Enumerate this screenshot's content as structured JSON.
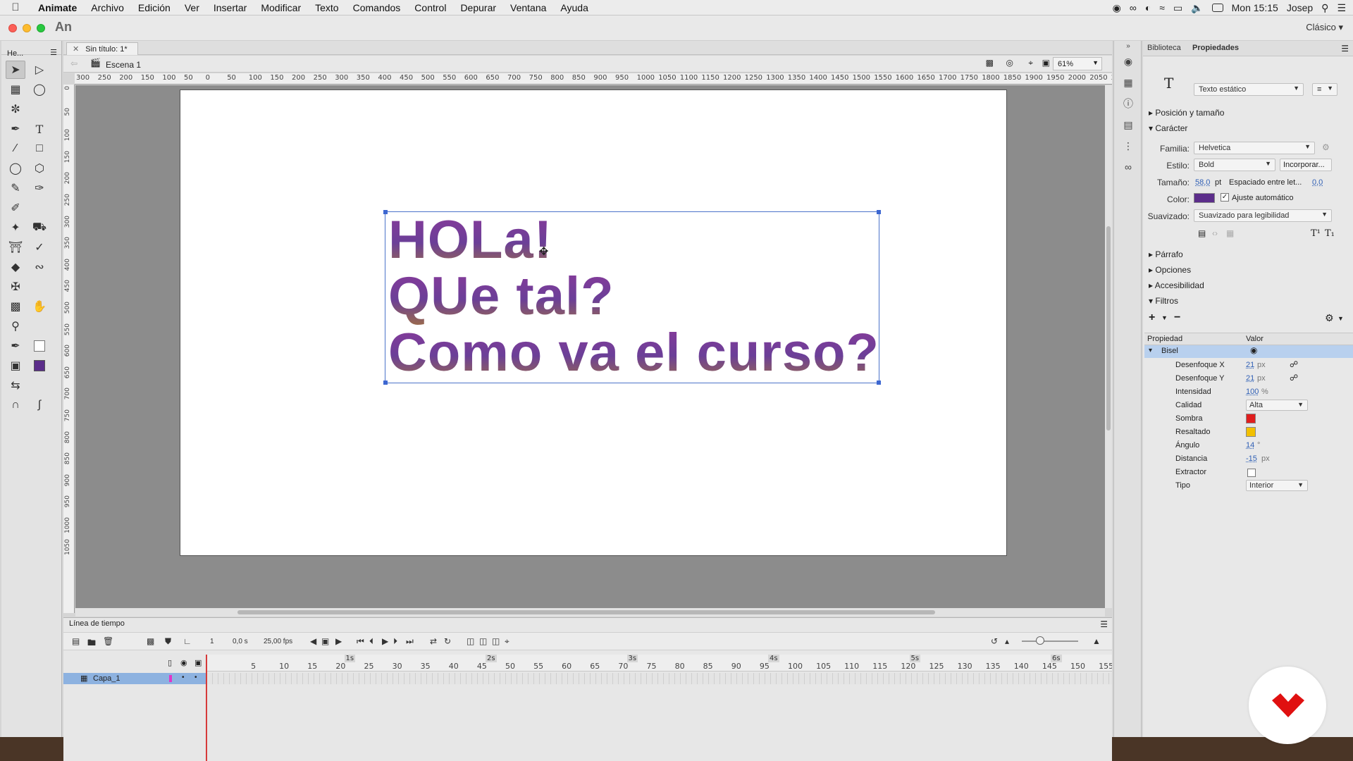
{
  "menubar": {
    "items": [
      "Animate",
      "Archivo",
      "Edición",
      "Ver",
      "Insertar",
      "Modificar",
      "Texto",
      "Comandos",
      "Control",
      "Depurar",
      "Ventana",
      "Ayuda"
    ],
    "clock": "Mon 15:15",
    "user": "Josep"
  },
  "titlebar": {
    "logo": "An",
    "workspace": "Clásico"
  },
  "tools_panel": {
    "title": "He..."
  },
  "document": {
    "tab": "Sin título: 1*",
    "scene": "Escena 1",
    "zoom": "61%"
  },
  "rulers": {
    "h_ticks": [
      "300",
      "250",
      "200",
      "150",
      "100",
      "50",
      "0",
      "50",
      "100",
      "150",
      "200",
      "250",
      "300",
      "350",
      "400",
      "450",
      "500",
      "550",
      "600",
      "650",
      "700",
      "750",
      "800",
      "850",
      "900",
      "950",
      "1000",
      "1050",
      "1100",
      "1150",
      "1200",
      "1250",
      "1300",
      "1350",
      "1400",
      "1450",
      "1500",
      "1550",
      "1600",
      "1650",
      "1700",
      "1750",
      "1800",
      "1850",
      "1900",
      "1950",
      "2000",
      "2050",
      "2"
    ],
    "v_ticks": [
      "0",
      "50",
      "100",
      "150",
      "200",
      "250",
      "300",
      "350",
      "400",
      "450",
      "500",
      "550",
      "600",
      "650",
      "700",
      "750",
      "800",
      "850",
      "900",
      "950",
      "1000",
      "1050"
    ]
  },
  "stage_text": {
    "line1": "HOLa!",
    "line2": "QUe tal?",
    "line3": "Como va el curso?"
  },
  "timeline": {
    "title": "Línea de tiempo",
    "time": "0,0 s",
    "fps": "25,00 fps",
    "current_frame": "1",
    "frame_numbers": [
      "5",
      "10",
      "15",
      "20",
      "25",
      "30",
      "35",
      "40",
      "45",
      "50",
      "55",
      "60",
      "65",
      "70",
      "75",
      "80",
      "85",
      "90",
      "95",
      "100",
      "105",
      "110",
      "115",
      "120",
      "125",
      "130",
      "135",
      "140",
      "145",
      "150",
      "155"
    ],
    "seconds": [
      "1s",
      "2s",
      "3s",
      "4s",
      "5s",
      "6s"
    ],
    "layer_name": "Capa_1"
  },
  "properties": {
    "tabs": [
      "Biblioteca",
      "Propiedades"
    ],
    "text_type": "Texto estático",
    "sections": {
      "position": "Posición y tamaño",
      "character": "Carácter",
      "paragraph": "Párrafo",
      "options": "Opciones",
      "accessibility": "Accesibilidad",
      "filters": "Filtros"
    },
    "family_label": "Familia:",
    "family": "Helvetica",
    "style_label": "Estilo:",
    "style": "Bold",
    "embed_button": "Incorporar...",
    "size_label": "Tamaño:",
    "size": "58,0",
    "size_unit": "pt",
    "spacing_label": "Espaciado entre let...",
    "spacing": "0,0",
    "color_label": "Color:",
    "text_color": "#5b2d8a",
    "auto_kern": "Ajuste automático",
    "smoothing_label": "Suavizado:",
    "smoothing": "Suavizado para legibilidad",
    "filter_headers": {
      "property": "Propiedad",
      "value": "Valor"
    },
    "filter_name": "Bisel",
    "filter_rows": [
      {
        "label": "Desenfoque X",
        "value": "21",
        "unit": "px"
      },
      {
        "label": "Desenfoque Y",
        "value": "21",
        "unit": "px"
      },
      {
        "label": "Intensidad",
        "value": "100",
        "unit": "%"
      },
      {
        "label": "Calidad",
        "value": "Alta",
        "unit": ""
      },
      {
        "label": "Sombra",
        "value": "",
        "unit": ""
      },
      {
        "label": "Resaltado",
        "value": "",
        "unit": ""
      },
      {
        "label": "Ángulo",
        "value": "14",
        "unit": "°"
      },
      {
        "label": "Distancia",
        "value": "-15",
        "unit": "px"
      },
      {
        "label": "Extractor",
        "value": "",
        "unit": ""
      },
      {
        "label": "Tipo",
        "value": "Interior",
        "unit": ""
      }
    ],
    "shadow_color": "#e01e1e",
    "highlight_color": "#f2c000"
  }
}
